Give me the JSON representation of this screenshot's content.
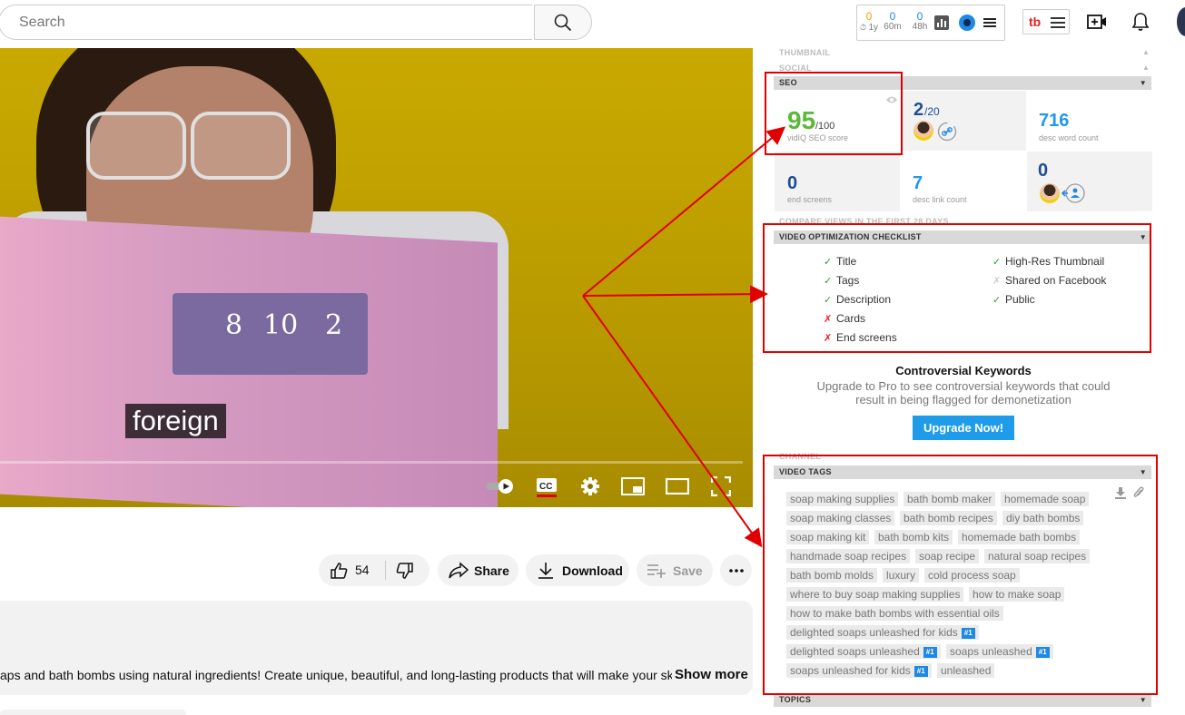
{
  "header": {
    "search_placeholder": "Search",
    "stats": [
      {
        "value": "0",
        "label": "1y",
        "color": "#f5a000"
      },
      {
        "value": "0",
        "label": "60m",
        "color": "#1e88e5"
      },
      {
        "value": "0",
        "label": "48h",
        "color": "#1e88e5"
      }
    ]
  },
  "video": {
    "caption": "foreign",
    "box_numbers": [
      "8",
      "10",
      "2"
    ]
  },
  "actions": {
    "likes": "54",
    "share": "Share",
    "download": "Download",
    "save": "Save"
  },
  "description": {
    "text": "aps and bath bombs using natural ingredients! Create unique, beautiful, and long-lasting products that will make your skin soft an",
    "show_more": "Show more"
  },
  "panel": {
    "faint_top": [
      "THUMBNAIL",
      "SOCIAL"
    ],
    "seo_header": "SEO",
    "seo": {
      "score": "95",
      "score_max": "/100",
      "score_label": "vidIQ SEO score",
      "tags_ratio": "2",
      "tags_ratio_max": "/20",
      "desc_word_count": "716",
      "desc_word_count_label": "desc word count",
      "end_screens": "0",
      "end_screens_label": "end screens",
      "desc_link_count": "7",
      "desc_link_count_label": "desc link count",
      "channel_links": "0"
    },
    "compare_views": "COMPARE VIEWS IN THE FIRST 28 DAYS",
    "checklist_header": "VIDEO OPTIMIZATION CHECKLIST",
    "checklist_left": [
      {
        "label": "Title",
        "status": "ok"
      },
      {
        "label": "Tags",
        "status": "ok"
      },
      {
        "label": "Description",
        "status": "ok"
      },
      {
        "label": "Cards",
        "status": "no"
      },
      {
        "label": "End screens",
        "status": "no"
      }
    ],
    "checklist_right": [
      {
        "label": "High-Res Thumbnail",
        "status": "ok"
      },
      {
        "label": "Shared on Facebook",
        "status": "na"
      },
      {
        "label": "Public",
        "status": "ok"
      }
    ],
    "controversial": {
      "title": "Controversial Keywords",
      "text": "Upgrade to Pro to see controversial keywords that could result in being flagged for demonetization",
      "button": "Upgrade Now!"
    },
    "channel_faint": "CHANNEL",
    "tags_header": "VIDEO TAGS",
    "tags": [
      {
        "text": "soap making supplies"
      },
      {
        "text": "bath bomb maker"
      },
      {
        "text": "homemade soap"
      },
      {
        "text": "soap making classes"
      },
      {
        "text": "bath bomb recipes"
      },
      {
        "text": "diy bath bombs"
      },
      {
        "text": "soap making kit"
      },
      {
        "text": "bath bomb kits"
      },
      {
        "text": "homemade bath bombs"
      },
      {
        "text": "handmade soap recipes"
      },
      {
        "text": "soap recipe"
      },
      {
        "text": "natural soap recipes"
      },
      {
        "text": "bath bomb molds"
      },
      {
        "text": "luxury"
      },
      {
        "text": "cold process soap"
      },
      {
        "text": "where to buy soap making supplies"
      },
      {
        "text": "how to make soap"
      },
      {
        "text": "how to make bath bombs with essential oils"
      },
      {
        "text": "delighted soaps unleashed for kids",
        "rank": "#1"
      },
      {
        "text": "delighted soaps unleashed",
        "rank": "#1"
      },
      {
        "text": "soaps unleashed",
        "rank": "#1"
      },
      {
        "text": "soaps unleashed for kids",
        "rank": "#1"
      },
      {
        "text": "unleashed"
      }
    ],
    "topics_header": "TOPICS"
  },
  "colors": {
    "annotation_red": "#e00000",
    "seo_score_green": "#5bb93a",
    "value_blue": "#1d4e91",
    "link_blue": "#2196f3",
    "upgrade_button": "#1e9be9"
  }
}
